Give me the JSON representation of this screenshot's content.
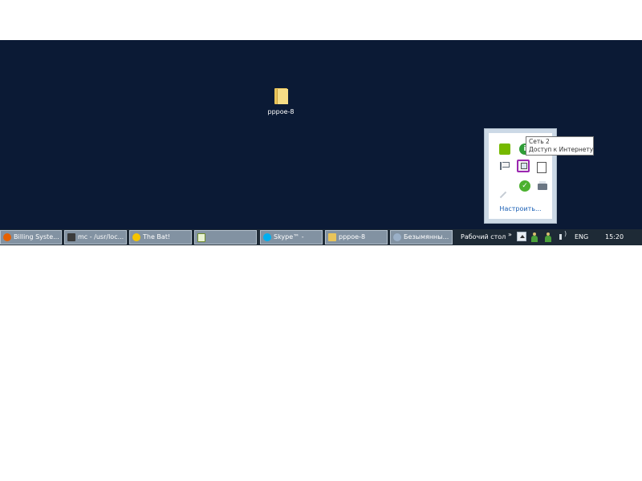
{
  "desktop": {
    "icons": [
      {
        "label": "pppoe-8",
        "icon": "folder-icon"
      }
    ]
  },
  "tray_popup": {
    "icons": [
      "nvidia-icon",
      "info-icon",
      "flag-icon",
      "network-icon",
      "document-icon",
      "pen-icon",
      "check-shield-icon",
      "printer-icon"
    ],
    "customize_link": "Настроить..."
  },
  "tooltip": {
    "line1": "Сеть  2",
    "line2": "Доступ к Интернету"
  },
  "taskbar": {
    "buttons": [
      {
        "label": "Billing Syste...",
        "icon": "firefox-icon"
      },
      {
        "label": "mc - /usr/loc...",
        "icon": "terminal-icon"
      },
      {
        "label": "The Bat!",
        "icon": "the-bat-icon"
      },
      {
        "label": "",
        "icon": "document-icon"
      },
      {
        "label": "Skype™ -",
        "icon": "skype-icon"
      },
      {
        "label": "pppoe-8",
        "icon": "folder-icon"
      },
      {
        "label": "Безымянны...",
        "icon": "paint-icon"
      }
    ],
    "desktop_toolbar": "Рабочий стол",
    "toolbar_chevron": "»",
    "language": "ENG",
    "clock": "15:20"
  },
  "colors": {
    "desktop_bg": "#0b1a35",
    "taskbar_bg": "#1e2a36",
    "task_button_bg": "#8292a2",
    "highlight": "#9b27b0"
  }
}
